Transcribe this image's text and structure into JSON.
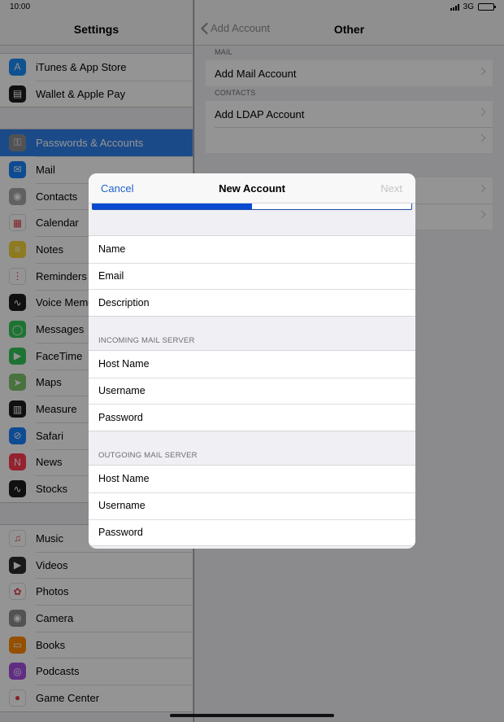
{
  "status_bar": {
    "time": "10:00",
    "network": "3G"
  },
  "settings": {
    "title": "Settings",
    "groups": [
      [
        {
          "label": "iTunes & App Store",
          "icon": "app-store-icon",
          "color": "#1d8cf8",
          "glyph": "A"
        },
        {
          "label": "Wallet & Apple Pay",
          "icon": "wallet-icon",
          "color": "#1c1c1e",
          "glyph": "▤"
        }
      ],
      [
        {
          "label": "Passwords & Accounts",
          "icon": "key-icon",
          "color": "#8e8e93",
          "glyph": "⚿",
          "selected": true
        },
        {
          "label": "Mail",
          "icon": "mail-icon",
          "color": "#1a82fb",
          "glyph": "✉"
        },
        {
          "label": "Contacts",
          "icon": "contacts-icon",
          "color": "#a8a8ad",
          "glyph": "◉"
        },
        {
          "label": "Calendar",
          "icon": "calendar-icon",
          "color": "#ffffff",
          "glyph": "▦"
        },
        {
          "label": "Notes",
          "icon": "notes-icon",
          "color": "#f5d23a",
          "glyph": "≡"
        },
        {
          "label": "Reminders",
          "icon": "reminders-icon",
          "color": "#ffffff",
          "glyph": "⋮"
        },
        {
          "label": "Voice Memos",
          "icon": "voice-memos-icon",
          "color": "#1c1c1e",
          "glyph": "∿"
        },
        {
          "label": "Messages",
          "icon": "messages-icon",
          "color": "#34c759",
          "glyph": "◯"
        },
        {
          "label": "FaceTime",
          "icon": "facetime-icon",
          "color": "#34c759",
          "glyph": "▶"
        },
        {
          "label": "Maps",
          "icon": "maps-icon",
          "color": "#7dc46b",
          "glyph": "➤"
        },
        {
          "label": "Measure",
          "icon": "measure-icon",
          "color": "#1c1c1e",
          "glyph": "▥"
        },
        {
          "label": "Safari",
          "icon": "safari-icon",
          "color": "#1a82fb",
          "glyph": "⊘"
        },
        {
          "label": "News",
          "icon": "news-icon",
          "color": "#ff3b52",
          "glyph": "N"
        },
        {
          "label": "Stocks",
          "icon": "stocks-icon",
          "color": "#1c1c1e",
          "glyph": "∿"
        }
      ],
      [
        {
          "label": "Music",
          "icon": "music-icon",
          "color": "#ffffff",
          "glyph": "♫"
        },
        {
          "label": "Videos",
          "icon": "videos-icon",
          "color": "#2c2c2e",
          "glyph": "▶"
        },
        {
          "label": "Photos",
          "icon": "photos-icon",
          "color": "#ffffff",
          "glyph": "✿"
        },
        {
          "label": "Camera",
          "icon": "camera-icon",
          "color": "#8e8e93",
          "glyph": "◉"
        },
        {
          "label": "Books",
          "icon": "books-icon",
          "color": "#ff8a00",
          "glyph": "▭"
        },
        {
          "label": "Podcasts",
          "icon": "podcasts-icon",
          "color": "#a64fe2",
          "glyph": "◎"
        },
        {
          "label": "Game Center",
          "icon": "game-center-icon",
          "color": "#ffffff",
          "glyph": "●"
        }
      ]
    ]
  },
  "other": {
    "back_label": "Add Account",
    "title": "Other",
    "sections": [
      {
        "header": "MAIL",
        "rows": [
          "Add Mail Account"
        ]
      },
      {
        "header": "CONTACTS",
        "rows": [
          "Add LDAP Account",
          ""
        ]
      },
      {
        "header": "",
        "rows": [
          "",
          ""
        ]
      }
    ]
  },
  "modal": {
    "title": "New Account",
    "cancel": "Cancel",
    "next": "Next",
    "progress": 0.5,
    "fields": [
      "Name",
      "Email",
      "Description"
    ],
    "incoming": {
      "header": "INCOMING MAIL SERVER",
      "fields": [
        "Host Name",
        "Username",
        "Password"
      ]
    },
    "outgoing": {
      "header": "OUTGOING MAIL SERVER",
      "fields": [
        "Host Name",
        "Username",
        "Password"
      ]
    }
  },
  "colors": {
    "accent": "#1f62c9",
    "progress": "#0a4ad1",
    "selected_row": "#2f80ed"
  }
}
